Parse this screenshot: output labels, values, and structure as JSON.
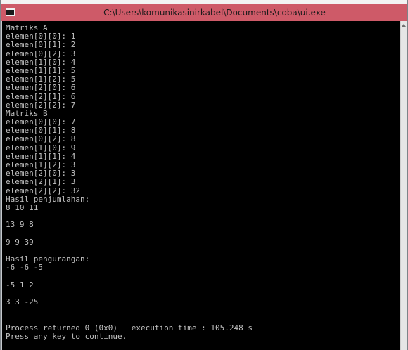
{
  "window": {
    "title": "C:\\Users\\komunikasinirkabel\\Documents\\coba\\ui.exe",
    "icon": "console-app-icon"
  },
  "console": {
    "lines": [
      "Matriks A",
      "elemen[0][0]: 1",
      "elemen[0][1]: 2",
      "elemen[0][2]: 3",
      "elemen[1][0]: 4",
      "elemen[1][1]: 5",
      "elemen[1][2]: 5",
      "elemen[2][0]: 6",
      "elemen[2][1]: 6",
      "elemen[2][2]: 7",
      "Matriks B",
      "elemen[0][0]: 7",
      "elemen[0][1]: 8",
      "elemen[0][2]: 8",
      "elemen[1][0]: 9",
      "elemen[1][1]: 4",
      "elemen[1][2]: 3",
      "elemen[2][0]: 3",
      "elemen[2][1]: 3",
      "elemen[2][2]: 32",
      "Hasil penjumlahan:",
      "8 10 11",
      "",
      "13 9 8",
      "",
      "9 9 39",
      "",
      "Hasil pengurangan:",
      "-6 -6 -5",
      "",
      "-5 1 2",
      "",
      "3 3 -25",
      "",
      "",
      "Process returned 0 (0x0)   execution time : 105.248 s",
      "Press any key to continue."
    ]
  },
  "colors": {
    "titlebar": "#ce5a68",
    "console_bg": "#000000",
    "console_fg": "#c0c0c0"
  }
}
